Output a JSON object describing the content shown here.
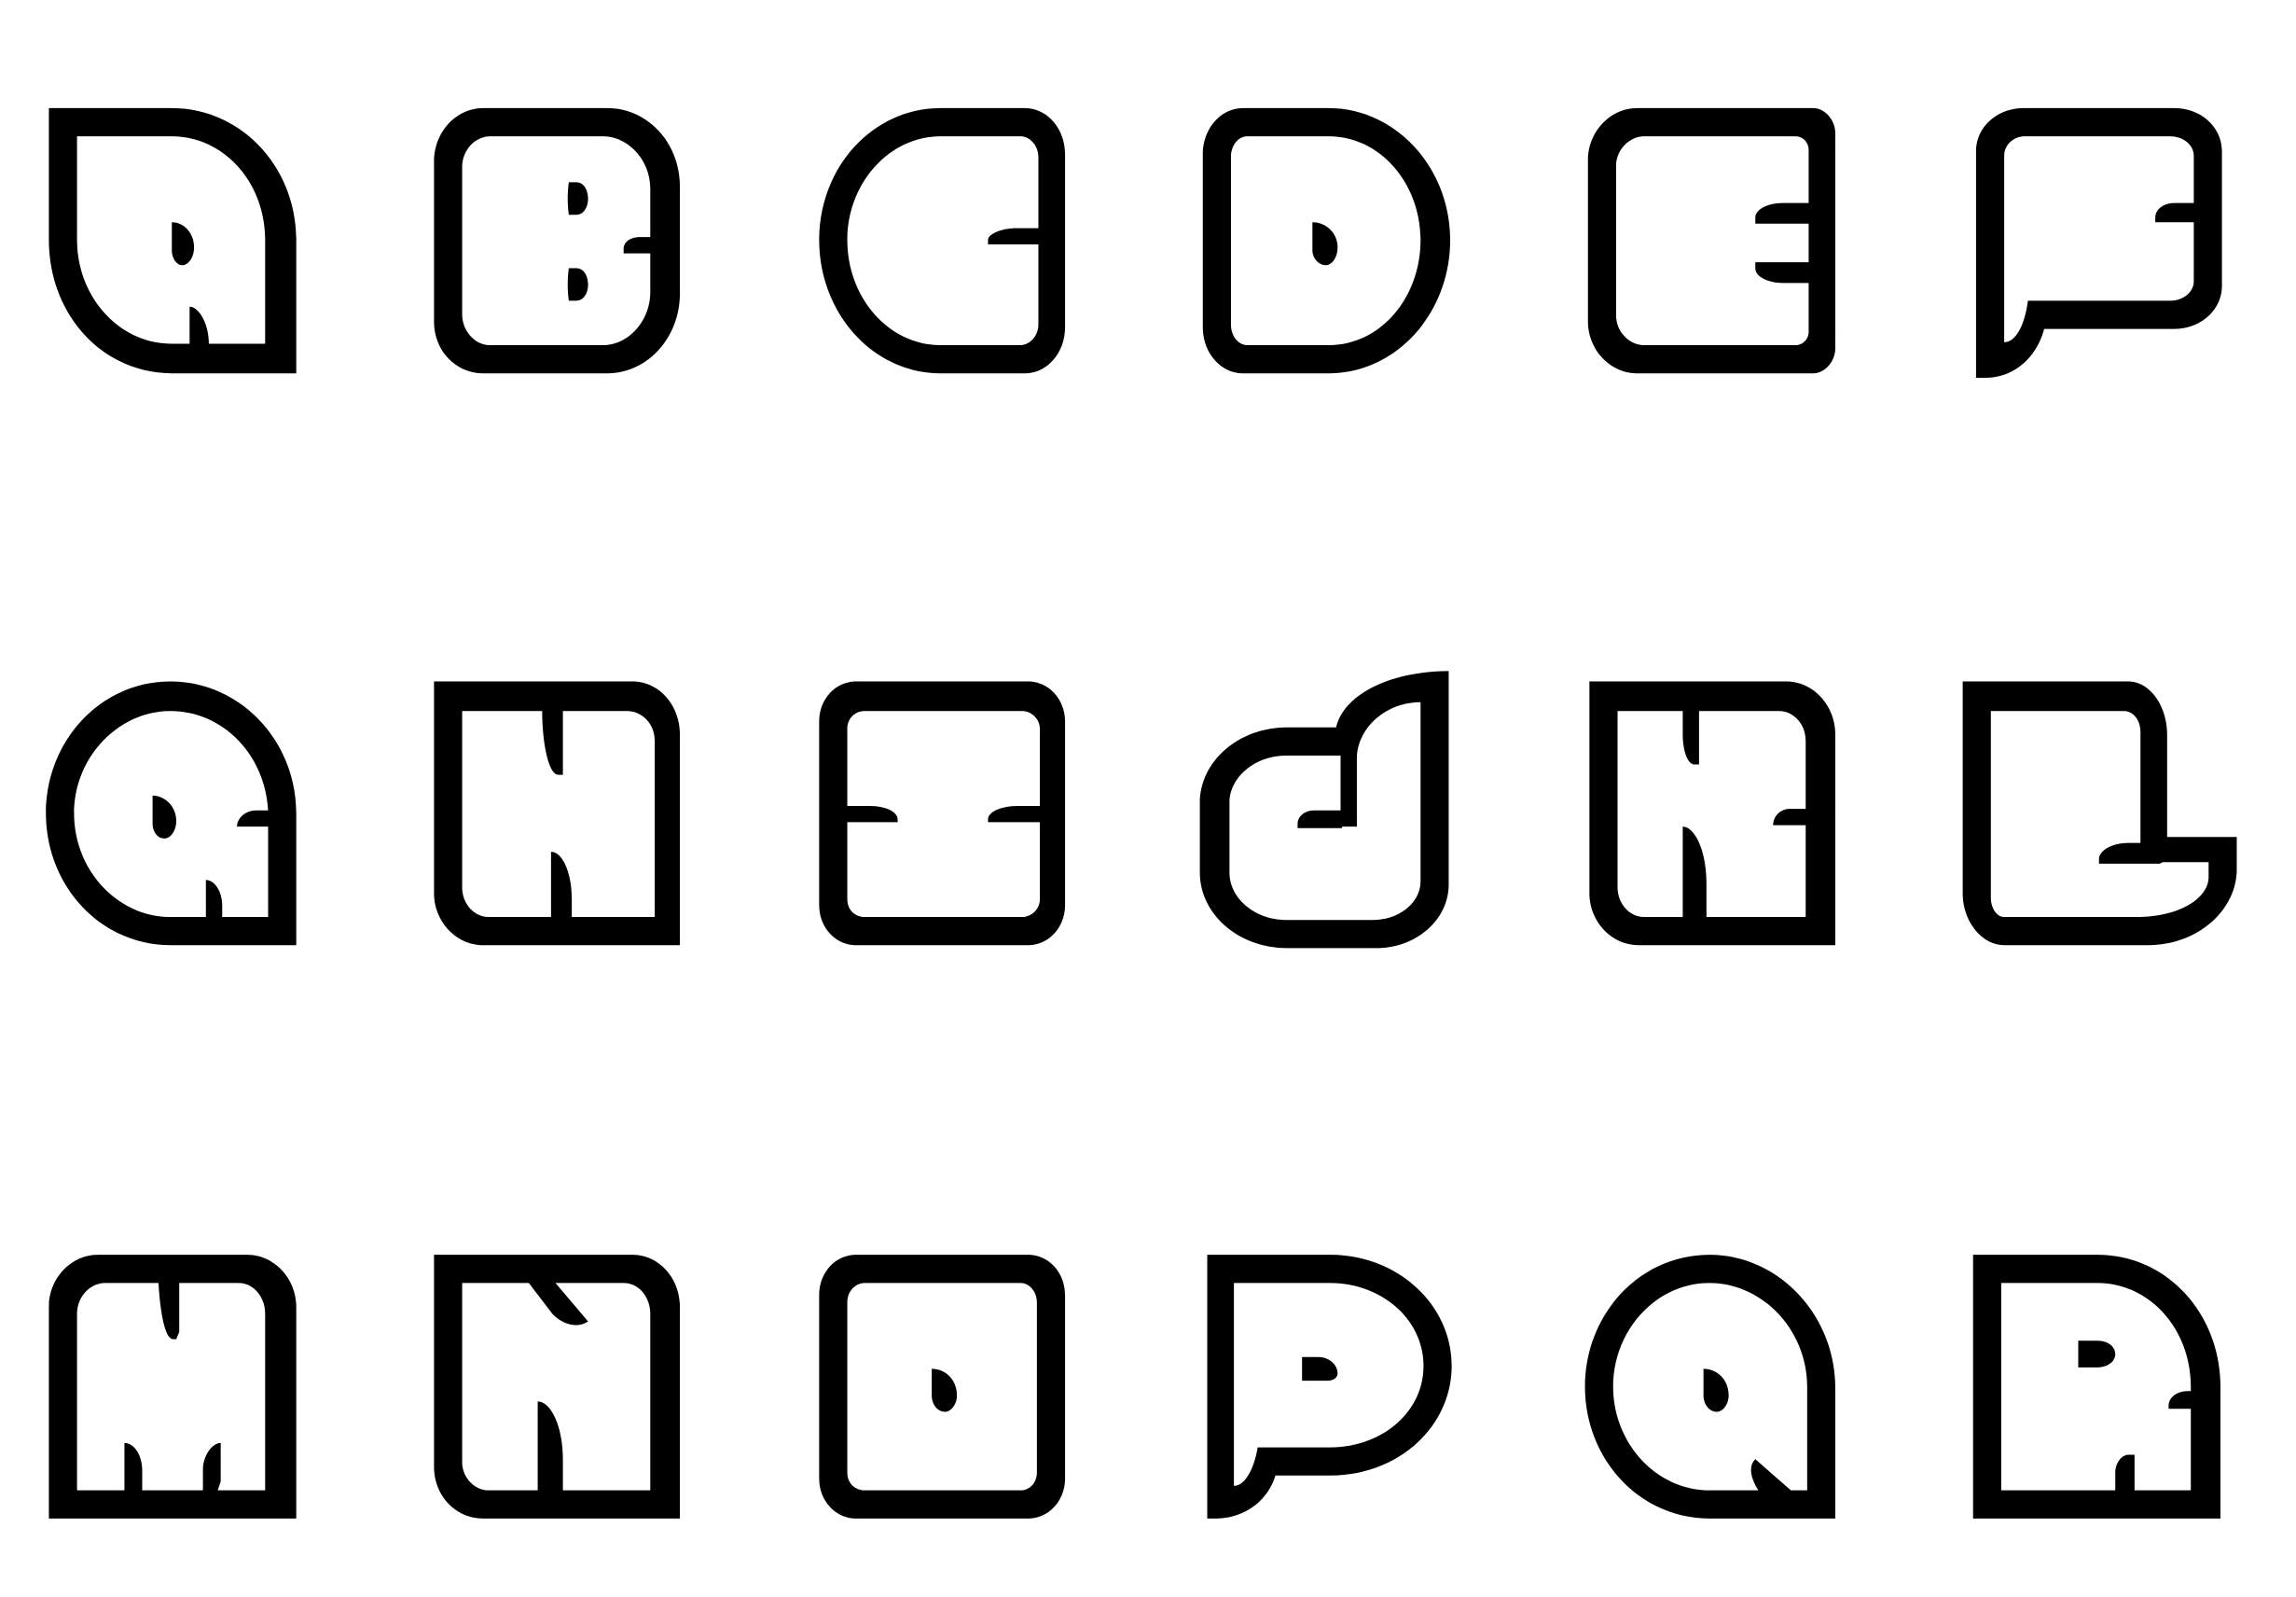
{
  "sheet": {
    "background_color": "#ffffff",
    "glyph_color": "#000000",
    "glyph_names": [
      "A",
      "B",
      "C",
      "D",
      "E",
      "F",
      "G",
      "H",
      "I",
      "J",
      "K",
      "L",
      "M",
      "N",
      "O",
      "P",
      "Q",
      "R"
    ]
  }
}
